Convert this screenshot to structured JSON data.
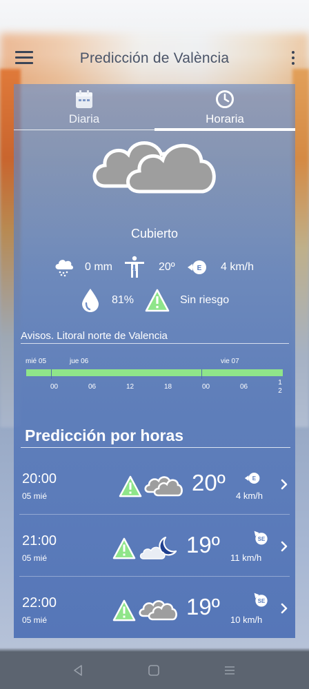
{
  "app": {
    "title": "Predicción de València"
  },
  "tabs": [
    {
      "label": "Diaria",
      "icon": "calendar-icon",
      "active": false
    },
    {
      "label": "Horaria",
      "icon": "clock-icon",
      "active": true
    }
  ],
  "current": {
    "condition": "Cubierto",
    "sky_icon": "cloudy-icon",
    "precipitation": "0 mm",
    "feels_like": "20º",
    "wind_direction": "E",
    "wind_speed": "4 km/h",
    "humidity": "81%",
    "risk": "Sin riesgo"
  },
  "warnings": {
    "title": "Avisos. Litoral norte de Valencia",
    "days": [
      "mié 05",
      "jue 06",
      "vie 07"
    ],
    "hours": [
      "00",
      "06",
      "12",
      "18",
      "00",
      "06",
      "1\n2"
    ],
    "level_color": "#8fe58a",
    "level": "Sin riesgo"
  },
  "hourly": {
    "title": "Predicción por horas",
    "rows": [
      {
        "time": "20:00",
        "date": "05 mié",
        "sky": "cloudy-icon",
        "temp": "20º",
        "wind_dir": "E",
        "wind_speed": "4 km/h"
      },
      {
        "time": "21:00",
        "date": "05 mié",
        "sky": "night-partly-cloudy-icon",
        "temp": "19º",
        "wind_dir": "SE",
        "wind_speed": "11 km/h"
      },
      {
        "time": "22:00",
        "date": "05 mié",
        "sky": "cloudy-icon",
        "temp": "19º",
        "wind_dir": "SE",
        "wind_speed": "10 km/h"
      }
    ]
  },
  "colors": {
    "accent": "#ffffff",
    "no_risk": "#8fe58a",
    "panel": "#5a7ec0"
  }
}
